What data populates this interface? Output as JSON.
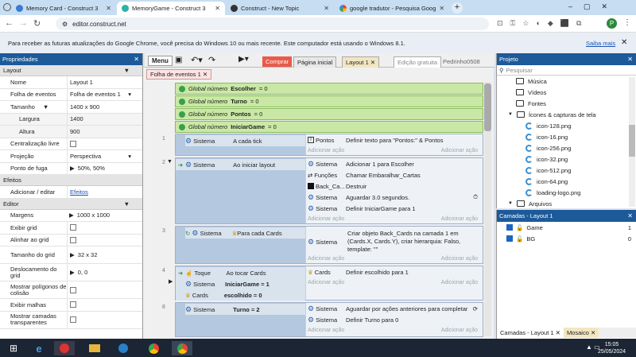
{
  "browser": {
    "tabs": [
      {
        "title": "Memory Card - Construct 3",
        "active": false
      },
      {
        "title": "MemoryGame - Construct 3",
        "active": true
      },
      {
        "title": "Construct - New Topic",
        "active": false
      },
      {
        "title": "google tradutor - Pesquisa Goog",
        "active": false
      }
    ],
    "url": "editor.construct.net",
    "profile": "P",
    "infobar": "Para receber as futuras atualizações do Google Chrome, você precisa do Windows 10 ou mais recente. Este computador está usando o Windows 8.1.",
    "infolink": "Saiba mais"
  },
  "toolbar": {
    "menu": "Menu",
    "buy": "Comprar",
    "home_tab": "Página inicial",
    "layout_tab": "Layout 1",
    "edition": "Edição gratuita",
    "user": "Pedrinho0508"
  },
  "props": {
    "title": "Propriedades",
    "section_layout": "Layout",
    "rows_layout": [
      {
        "k": "Nome",
        "v": "Layout 1"
      },
      {
        "k": "Folha de eventos",
        "v": "Folha de eventos 1"
      },
      {
        "k": "Tamanho",
        "v": "1400 x 900"
      },
      {
        "k": "Largura",
        "v": "1400"
      },
      {
        "k": "Altura",
        "v": "900"
      },
      {
        "k": "Centralização livre",
        "v": ""
      },
      {
        "k": "Projeção",
        "v": "Perspectiva"
      },
      {
        "k": "Ponto de fuga",
        "v": "50%, 50%"
      }
    ],
    "section_effects": "Efeitos",
    "effects_k": "Adicionar / editar",
    "effects_v": "Efeitos",
    "section_editor": "Editor",
    "rows_editor": [
      {
        "k": "Margens",
        "v": "1000 x 1000"
      },
      {
        "k": "Exibir grid",
        "v": ""
      },
      {
        "k": "Alinhar ao grid",
        "v": ""
      },
      {
        "k": "Tamanho do grid",
        "v": "32 x 32"
      },
      {
        "k": "Deslocamento do grid",
        "v": "0, 0"
      },
      {
        "k": "Mostrar polígonos de colisão",
        "v": ""
      },
      {
        "k": "Exibir malhas",
        "v": ""
      },
      {
        "k": "Mostrar camadas transparentes",
        "v": ""
      }
    ]
  },
  "sheet": {
    "tab": "Folha de eventos 1",
    "globals": [
      {
        "kw": "Global número",
        "name": "Escolher",
        "val": "= 0"
      },
      {
        "kw": "Global número",
        "name": "Turno",
        "val": "= 0"
      },
      {
        "kw": "Global número",
        "name": "Pontos",
        "val": "= 0"
      },
      {
        "kw": "Global número",
        "name": "IniciarGame",
        "val": "= 0"
      }
    ],
    "add_action": "Adicionar ação",
    "events": [
      {
        "num": "1",
        "conds": [
          {
            "obj": "Sistema",
            "text": "A cada tick"
          }
        ],
        "acts": [
          {
            "obj": "Pontos",
            "text": "Definir texto para \"Pontos:\" & Pontos"
          }
        ]
      },
      {
        "num": "2",
        "conds": [
          {
            "obj": "Sistema",
            "text": "Ao iniciar layout"
          }
        ],
        "acts": [
          {
            "obj": "Sistema",
            "text": "Adicionar 1 para Escolher"
          },
          {
            "obj": "Funções",
            "text": "Chamar Embaralhar_Cartas"
          },
          {
            "obj": "Back_Ca...",
            "text": "Destruir"
          },
          {
            "obj": "Sistema",
            "text": "Aguardar 3.0 segundos."
          },
          {
            "obj": "Sistema",
            "text": "Definir IniciarGame para 1"
          }
        ]
      },
      {
        "num": "3",
        "conds": [
          {
            "obj": "Sistema",
            "text": "Para cada  Cards"
          }
        ],
        "acts": [
          {
            "obj": "Sistema",
            "text": "Criar objeto  Back_Cards na camada 1 em (Cards.X, Cards.Y), criar hierarquia: Falso, template: \"\""
          }
        ]
      },
      {
        "num": "4",
        "conds": [
          {
            "obj": "Toque",
            "text": "Ao tocar  Cards"
          },
          {
            "obj": "Sistema",
            "text": "IniciarGame = 1"
          },
          {
            "obj": "Cards",
            "text": "escolhido = 0"
          }
        ],
        "acts": [
          {
            "obj": "Cards",
            "text": "Definir escolhido para 1"
          }
        ]
      },
      {
        "num": "8",
        "conds": [
          {
            "obj": "Sistema",
            "text": "Turno = 2"
          }
        ],
        "acts": [
          {
            "obj": "Sistema",
            "text": "Aguardar por ações anteriores para completar"
          },
          {
            "obj": "Sistema",
            "text": "Definir Turno para 0"
          }
        ]
      }
    ]
  },
  "project": {
    "title": "Projeto",
    "search_placeholder": "Pesquisar",
    "items": [
      "Música",
      "Vídeos",
      "Fontes",
      "Ícones & capturas de tela",
      "icon-128.png",
      "icon-16.png",
      "icon-256.png",
      "icon-32.png",
      "icon-512.png",
      "icon-64.png",
      "loading-logo.png",
      "Arquivos"
    ]
  },
  "layers": {
    "title": "Camadas - Layout 1",
    "rows": [
      {
        "name": "Game",
        "num": "1"
      },
      {
        "name": "BG",
        "num": "0"
      }
    ],
    "tab1": "Camadas - Layout 1",
    "tab2": "Mosaico"
  },
  "taskbar": {
    "time": "15:05",
    "date": "25/05/2024"
  }
}
